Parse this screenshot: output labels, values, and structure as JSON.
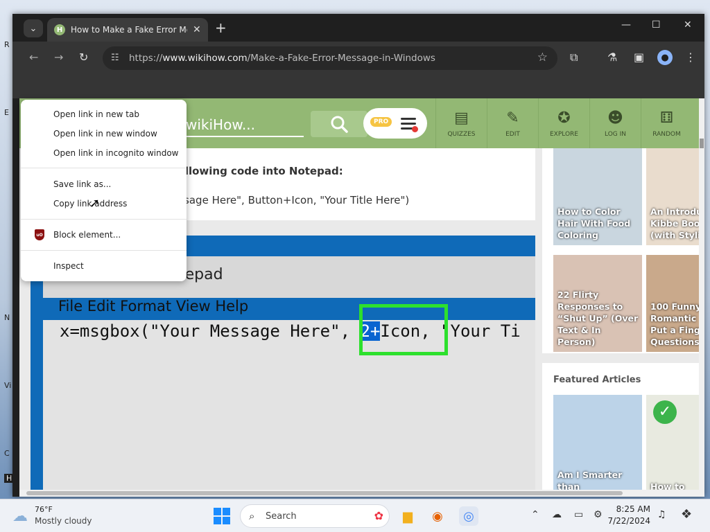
{
  "browser": {
    "tab_title": "How to Make a Fake Error Message in Windows",
    "tab_favicon_letter": "H",
    "new_tab_label": "+",
    "url_prefix": "https://",
    "url_host": "www.wikihow.com",
    "url_path": "/Make-a-Fake-Error-Message-in-Windows"
  },
  "wikihow": {
    "search_placeholder": "wikiHow...",
    "pro_badge": "PRO",
    "nav": [
      {
        "label": "QUIZZES",
        "icon": "quizzes-icon"
      },
      {
        "label": "EDIT",
        "icon": "pencil-icon"
      },
      {
        "label": "EXPLORE",
        "icon": "compass-icon"
      },
      {
        "label": "LOG IN",
        "icon": "user-icon"
      },
      {
        "label": "RANDOM",
        "icon": "dice-icon"
      }
    ],
    "step_text": "following code into Notepad:",
    "code_text": "essage Here\", Button+Icon, \"Your Title Here\")"
  },
  "notepad_image": {
    "title": "tepad",
    "menu": "File Edit Format View Help",
    "code_before": "x=msgbox(\"Your Message Here\",",
    "code_selected": "2+",
    "code_after": "Icon, \"Your Ti"
  },
  "sidebar": {
    "cards": [
      {
        "text": "How to Color Hair With Food Coloring",
        "bg": "#c9d6df"
      },
      {
        "text": "An Introdu Kibbe Boo (with Styli",
        "bg": "#e9dccd"
      },
      {
        "text": "22 Flirty Responses to “Shut Up” (Over Text & In Person)",
        "bg": "#d9c2b4"
      },
      {
        "text": "100 Funny Romantic Put a Fing Questions",
        "bg": "#c9a98b"
      }
    ],
    "featured_title": "Featured Articles",
    "featured_cards": [
      {
        "text": "Am I Smarter than",
        "bg": "#bcd3e8"
      },
      {
        "text": "How to",
        "bg": "#e8eae0"
      }
    ]
  },
  "context_menu": {
    "items": [
      "Open link in new tab",
      "Open link in new window",
      "Open link in incognito window",
      "Save link as...",
      "Copy link address",
      "Block element...",
      "Inspect"
    ],
    "ublock_label": "uO"
  },
  "taskbar": {
    "weather_temp": "76°F",
    "weather_desc": "Mostly cloudy",
    "search_label": "Search",
    "time": "8:25 AM",
    "date": "7/22/2024"
  },
  "desktop_letters": [
    "R",
    "E",
    "N",
    "Vi",
    "C",
    "H"
  ]
}
